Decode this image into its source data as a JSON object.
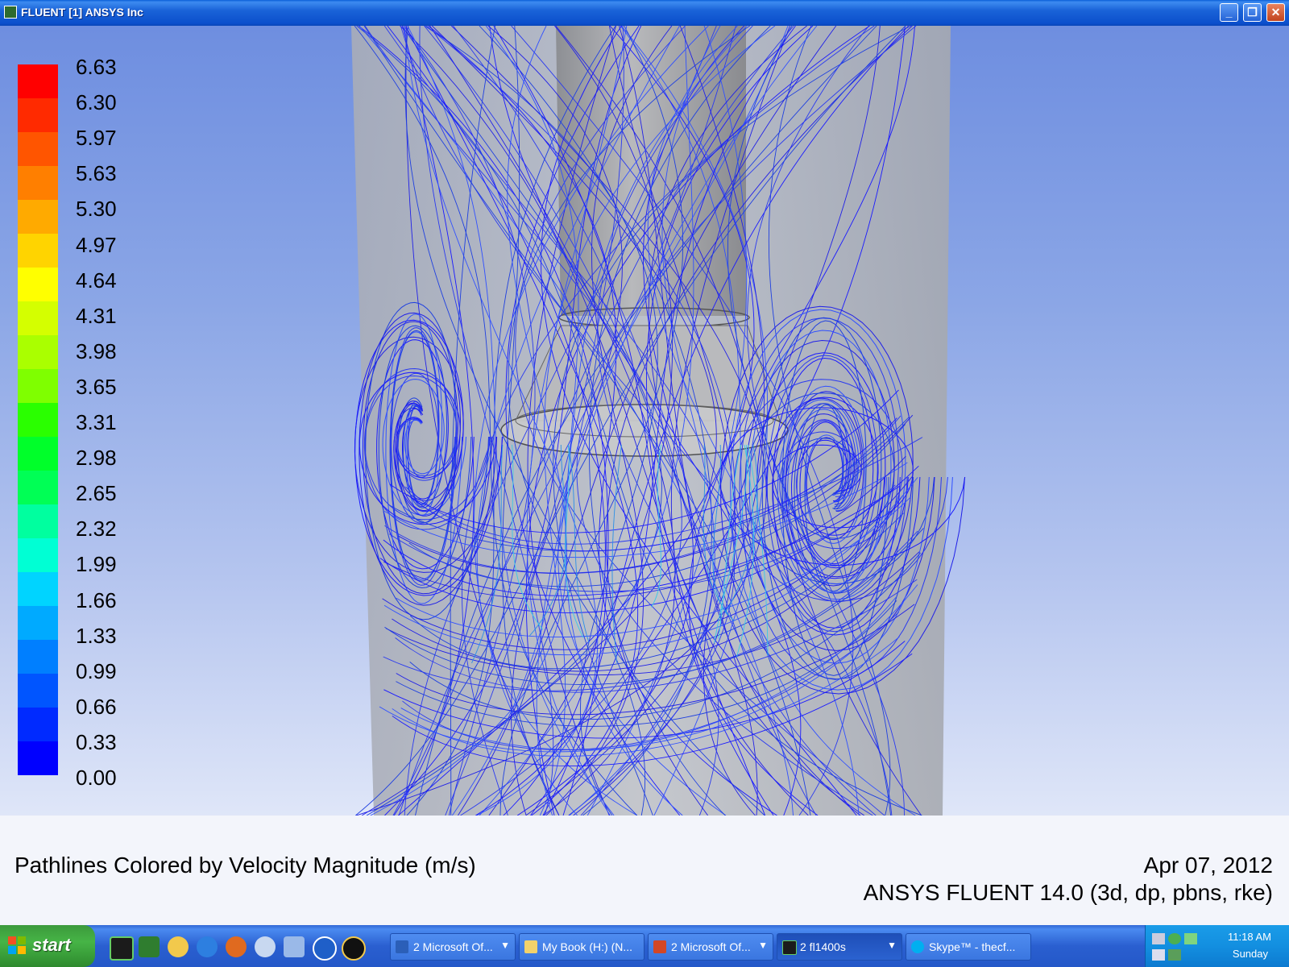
{
  "window": {
    "title": "FLUENT [1] ANSYS Inc",
    "minimize_glyph": "_",
    "maximize_glyph": "❐",
    "close_glyph": "✕"
  },
  "legend": {
    "labels": [
      "6.63",
      "6.30",
      "5.97",
      "5.63",
      "5.30",
      "4.97",
      "4.64",
      "4.31",
      "3.98",
      "3.65",
      "3.31",
      "2.98",
      "2.65",
      "2.32",
      "1.99",
      "1.66",
      "1.33",
      "0.99",
      "0.66",
      "0.33",
      "0.00"
    ],
    "colors": [
      "#ff0000",
      "#ff2a00",
      "#ff5500",
      "#ff7f00",
      "#ffaa00",
      "#ffd400",
      "#ffff00",
      "#d4ff00",
      "#aaff00",
      "#7fff00",
      "#2aff00",
      "#00ff2a",
      "#00ff55",
      "#00ff9f",
      "#00ffd4",
      "#00d4ff",
      "#00aaff",
      "#007fff",
      "#0055ff",
      "#002aff",
      "#0000ff"
    ]
  },
  "caption": {
    "left": "Pathlines Colored by Velocity Magnitude (m/s)",
    "date": "Apr 07, 2012",
    "version": "ANSYS FLUENT 14.0 (3d, dp, pbns, rke)"
  },
  "taskbar": {
    "start_label": "start",
    "tasks": [
      {
        "label": "2 Microsoft Of...",
        "icon": "word-icon",
        "dropdown": "▼"
      },
      {
        "label": "My Book (H:) (N...",
        "icon": "folder-icon",
        "dropdown": ""
      },
      {
        "label": "2 Microsoft Of...",
        "icon": "powerpoint-icon",
        "dropdown": "▼"
      },
      {
        "label": "2 fl1400s",
        "icon": "fluent-icon",
        "dropdown": "▼"
      },
      {
        "label": "Skype™ - thecf...",
        "icon": "skype-icon",
        "dropdown": ""
      }
    ],
    "clock": "11:18 AM",
    "day": "Sunday"
  }
}
